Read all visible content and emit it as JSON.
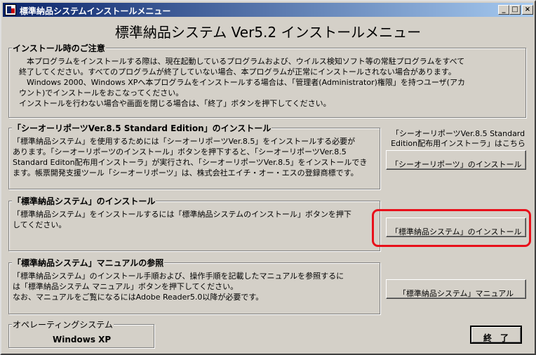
{
  "window": {
    "title": "標準納品システムインストールメニュー",
    "minimize": "_",
    "maximize": "□",
    "close": "×"
  },
  "main_title": "標準納品システム Ver5.2 インストールメニュー",
  "notice": {
    "title": "インストール時のご注意",
    "body": "　本プログラムをインストールする際は、現在起動しているプログラムおよび、ウイルス検知ソフト等の常駐プログラムをすべて\n終了してください。すべてのプログラムが終了していない場合、本プログラムが正常にインストールされない場合があります。\n　Windows 2000、Windows XPへ本プログラムをインストールする場合は、「管理者(Administrator)権限」を持つユーザ(アカ\nウント)でインストールをおこなってください。\nインストールを行わない場合や画面を閉じる場合は、「終了」ボタンを押下してください。"
  },
  "ciaoreports": {
    "title": "「シーオーリポーツVer.8.5 Standard Edition」のインストール",
    "body": "「標準納品システム」を使用するためには「シーオーリポーツVer.8.5」をインストールする必要が\nあります。「シーオーリポーツのインストール」ボタンを押下すると、「シーオーリポーツVer.8.5\nStandard Editon配布用インストーラ」が実行され、「シーオーリポーツVer.8.5」をインストールでき\nます。帳票開発支援ツール「シーオーリポーツ」は、株式会社エイチ・オー・エスの登録商標です。",
    "side_note": "「シーオーリポーツVer.8.5 Standard\nEdition配布用インストーラ」はこちら",
    "button_label": "「シーオーリポーツ」のインストール"
  },
  "system_install": {
    "title": "「標準納品システム」のインストール",
    "body": "「標準納品システム」をインストールするには「標準納品システムのインストール」ボタンを押下\nしてください。",
    "button_label": "「標準納品システム」のインストール",
    "highlight_color": "#e8101a"
  },
  "manual": {
    "title": "「標準納品システム」マニュアルの参照",
    "body": "「標準納品システム」のインストール手順および、操作手順を記載したマニュアルを参照するに\nは「標準納品システム マニュアル」ボタンを押下してください。\nなお、マニュアルをご覧になるにはAdobe Reader5.0以降が必要です。",
    "button_label": "「標準納品システム」マニュアル"
  },
  "os": {
    "title": "オペレーティングシステム",
    "value": "Windows XP"
  },
  "exit_button_label": "終　了"
}
